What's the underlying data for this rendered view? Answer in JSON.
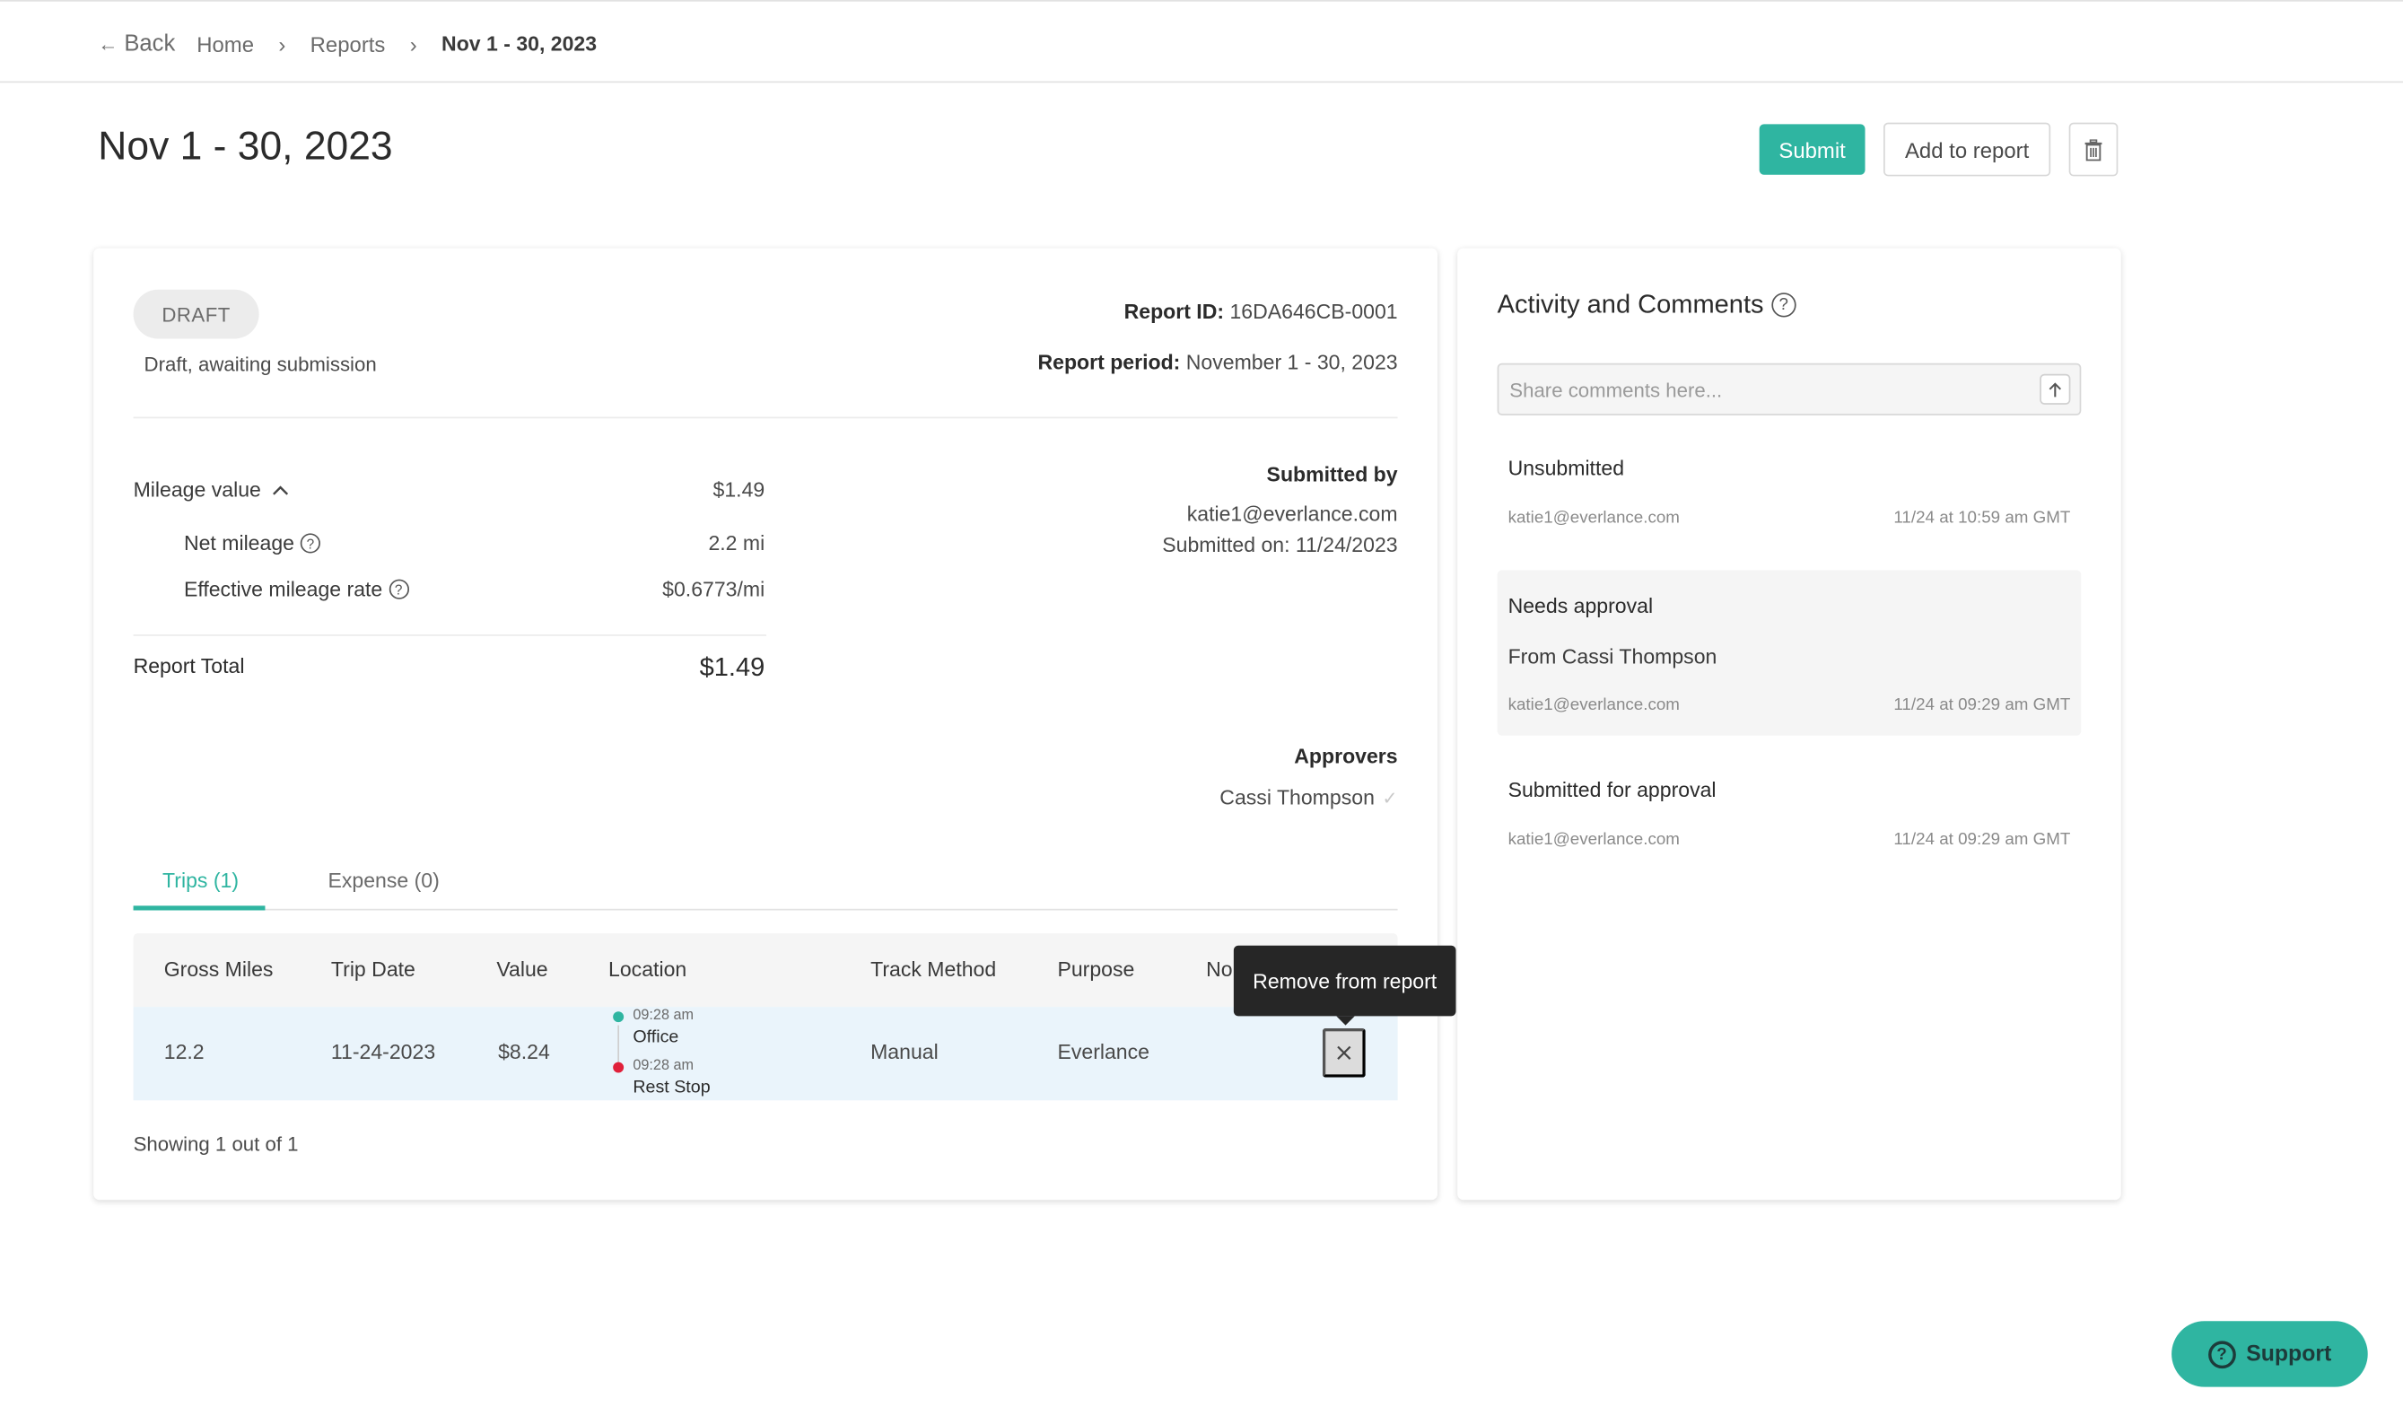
{
  "breadcrumb": {
    "back_label": "Back",
    "items": [
      "Home",
      "Reports"
    ],
    "current": "Nov 1 - 30, 2023"
  },
  "page": {
    "title": "Nov 1 - 30, 2023"
  },
  "actions": {
    "submit_label": "Submit",
    "add_label": "Add to report",
    "trash_icon": "trash-icon"
  },
  "report": {
    "status_badge": "DRAFT",
    "status_text": "Draft, awaiting submission",
    "id_label": "Report ID:",
    "id_value": "16DA646CB-0001",
    "period_label": "Report period:",
    "period_value": "November 1 - 30, 2023",
    "mileage_label": "Mileage value",
    "mileage_value": "$1.49",
    "net_mileage_label": "Net mileage",
    "net_mileage_value": "2.2 mi",
    "rate_label": "Effective mileage rate",
    "rate_value": "$0.6773/mi",
    "total_label": "Report Total",
    "total_value": "$1.49",
    "submitted_by_label": "Submitted by",
    "submitted_by_email": "katie1@everlance.com",
    "submitted_on": "Submitted on: 11/24/2023",
    "approvers_label": "Approvers",
    "approver_name": "Cassi Thompson"
  },
  "tabs": [
    {
      "label": "Trips (1)",
      "active": true
    },
    {
      "label": "Expense (0)",
      "active": false
    }
  ],
  "table": {
    "columns": [
      "Gross Miles",
      "Trip Date",
      "Value",
      "Location",
      "Track Method",
      "Purpose",
      "No"
    ],
    "rows": [
      {
        "gross_miles": "12.2",
        "trip_date": "11-24-2023",
        "value": "$8.24",
        "start_time": "09:28 am",
        "start_place": "Office",
        "end_time": "09:28 am",
        "end_place": "Rest Stop",
        "track_method": "Manual",
        "purpose": "Everlance"
      }
    ],
    "showing": "Showing 1 out of 1",
    "tooltip": "Remove from report"
  },
  "activity": {
    "title": "Activity and Comments",
    "comment_placeholder": "Share comments here...",
    "items": [
      {
        "title": "Unsubmitted",
        "sub": "",
        "email": "katie1@everlance.com",
        "time": "11/24 at 10:59 am GMT"
      },
      {
        "title": "Needs approval",
        "sub": "From Cassi Thompson",
        "email": "katie1@everlance.com",
        "time": "11/24 at 09:29 am GMT"
      },
      {
        "title": "Submitted for approval",
        "sub": "",
        "email": "katie1@everlance.com",
        "time": "11/24 at 09:29 am GMT"
      }
    ]
  },
  "support": {
    "label": "Support"
  },
  "colors": {
    "accent": "#2fb5a1",
    "start_dot": "#2fb5a1",
    "end_dot": "#e0203a",
    "row_highlight": "#eaf4fb"
  }
}
